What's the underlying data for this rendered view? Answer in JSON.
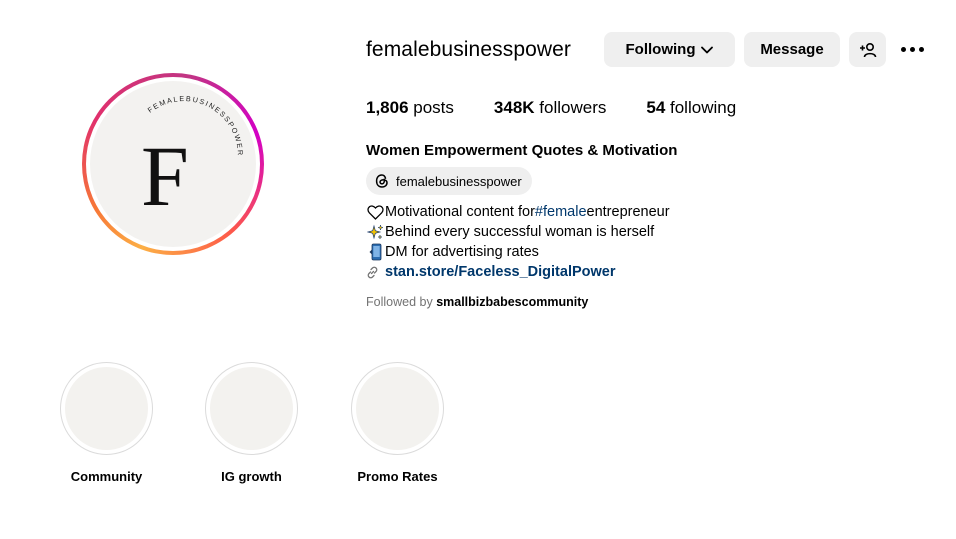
{
  "profile": {
    "username": "femalebusinesspower",
    "avatar_letter": "F",
    "avatar_arc_text": "FEMALEBUSINESSPOWER"
  },
  "actions": {
    "following_label": "Following",
    "message_label": "Message",
    "add_user_icon": "add-user-icon",
    "more_icon": "more-options-icon"
  },
  "stats": {
    "posts_count": "1,806",
    "posts_label": " posts",
    "followers_count": "348K",
    "followers_label": " followers",
    "following_count": "54",
    "following_label": " following"
  },
  "bio": {
    "title": "Women Empowerment Quotes & Motivation",
    "threads_handle": "femalebusinesspower",
    "line1_prefix": "Motivational content for ",
    "line1_hashtag": "#female",
    "line1_suffix": " entrepreneur",
    "line2": "Behind every successful woman is herself",
    "line3": "DM for advertising rates",
    "link": "stan.store/Faceless_DigitalPower",
    "followed_by_prefix": "Followed by ",
    "followed_by_user": "smallbizbabescommunity"
  },
  "highlights": [
    {
      "label": "Community"
    },
    {
      "label": "IG growth"
    },
    {
      "label": "Promo Rates"
    }
  ],
  "colors": {
    "button_bg": "#efefef",
    "link": "#00376b",
    "muted": "#737373"
  }
}
